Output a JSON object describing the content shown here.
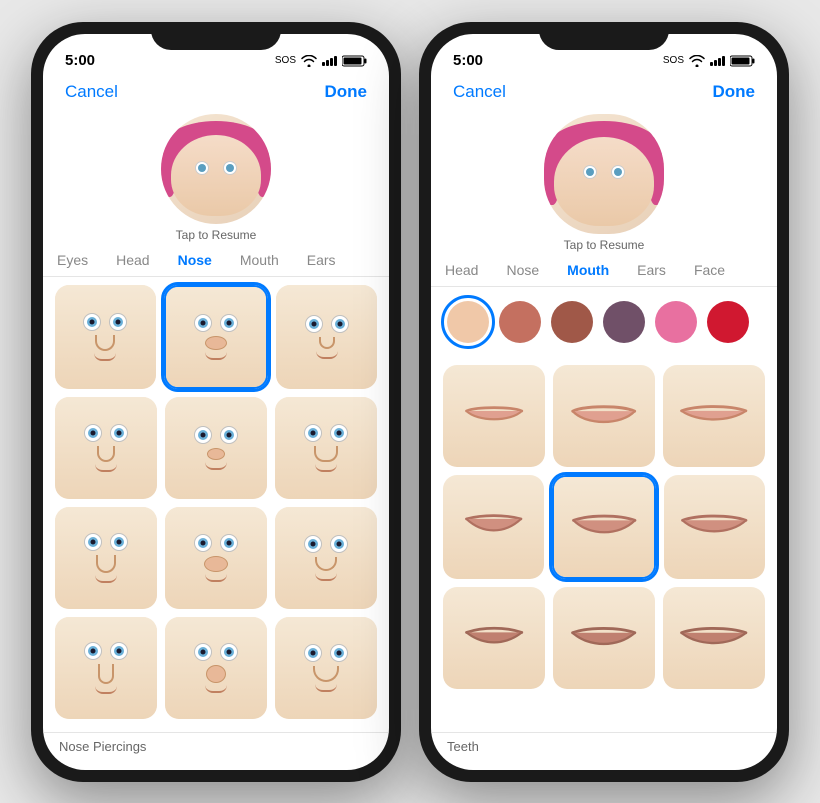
{
  "phone1": {
    "statusBar": {
      "time": "5:00",
      "sos": "SOS",
      "wifi": true,
      "battery": true
    },
    "nav": {
      "cancel": "Cancel",
      "done": "Done"
    },
    "avatar": {
      "tapToResume": "Tap to Resume"
    },
    "tabs": [
      {
        "label": "Eyes",
        "active": false
      },
      {
        "label": "Head",
        "active": false
      },
      {
        "label": "Nose",
        "active": true
      },
      {
        "label": "Mouth",
        "active": false
      },
      {
        "label": "Ears",
        "active": false
      }
    ],
    "grid": {
      "rows": 4,
      "cols": 3,
      "selectedRow": 0,
      "selectedCol": 1
    },
    "bottomLabel": "Nose Piercings"
  },
  "phone2": {
    "statusBar": {
      "time": "5:00",
      "sos": "SOS",
      "wifi": true,
      "battery": true
    },
    "nav": {
      "cancel": "Cancel",
      "done": "Done"
    },
    "avatar": {
      "tapToResume": "Tap to Resume"
    },
    "tabs": [
      {
        "label": "Head",
        "active": false
      },
      {
        "label": "Nose",
        "active": false
      },
      {
        "label": "Mouth",
        "active": true
      },
      {
        "label": "Ears",
        "active": false
      },
      {
        "label": "Face",
        "active": false
      }
    ],
    "colorRow": [
      {
        "color": "#f0c8a8",
        "selected": true
      },
      {
        "color": "#c47060",
        "selected": false
      },
      {
        "color": "#a05848",
        "selected": false
      },
      {
        "color": "#705068",
        "selected": false
      },
      {
        "color": "#e870a0",
        "selected": false
      },
      {
        "color": "#d01830",
        "selected": false
      }
    ],
    "grid": {
      "rows": 3,
      "cols": 3,
      "selectedRow": 1,
      "selectedCol": 1
    },
    "bottomLabel": "Teeth"
  }
}
